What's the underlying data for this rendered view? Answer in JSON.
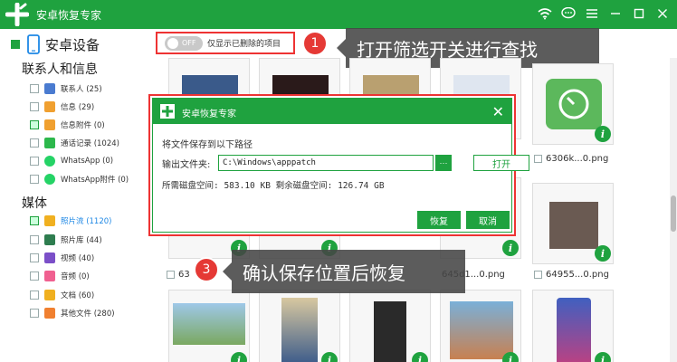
{
  "window": {
    "title": "安卓恢复专家",
    "accent": "#1fa23f"
  },
  "sidebar": {
    "device_label": "安卓设备",
    "sections": [
      {
        "title": "联系人和信息",
        "items": [
          {
            "label": "联系人 (25)",
            "icon": "contacts-icon",
            "color": "#4a7bd0",
            "state": "empty"
          },
          {
            "label": "信息 (29)",
            "icon": "message-icon",
            "color": "#f0a030",
            "state": "empty"
          },
          {
            "label": "信息附件 (0)",
            "icon": "message-attachment-icon",
            "color": "#f0a030",
            "state": "partial"
          },
          {
            "label": "通话记录 (1024)",
            "icon": "call-log-icon",
            "color": "#2db84c",
            "state": "empty"
          },
          {
            "label": "WhatsApp (0)",
            "icon": "whatsapp-icon",
            "color": "#25d366",
            "state": "empty"
          },
          {
            "label": "WhatsApp附件 (0)",
            "icon": "whatsapp-attachment-icon",
            "color": "#25d366",
            "state": "empty"
          }
        ]
      },
      {
        "title": "媒体",
        "items": [
          {
            "label": "照片流 (1120)",
            "icon": "photo-stream-icon",
            "color": "#f0b020",
            "state": "checked"
          },
          {
            "label": "照片库 (44)",
            "icon": "photo-library-icon",
            "color": "#2e7d4f",
            "state": "empty"
          },
          {
            "label": "视频 (40)",
            "icon": "video-icon",
            "color": "#7b4fc8",
            "state": "empty"
          },
          {
            "label": "音频 (0)",
            "icon": "audio-icon",
            "color": "#f06090",
            "state": "empty"
          },
          {
            "label": "文档 (60)",
            "icon": "document-icon",
            "color": "#f0b020",
            "state": "empty"
          },
          {
            "label": "其他文件 (280)",
            "icon": "other-files-icon",
            "color": "#f08030",
            "state": "empty"
          }
        ]
      }
    ]
  },
  "filter": {
    "toggle_text": "OFF",
    "label": "仅显示已删除的项目"
  },
  "callouts": {
    "step1_number": "1",
    "step1_text": "打开筛选开关进行查找",
    "step3_number": "3",
    "step3_text": "确认保存位置后恢复"
  },
  "grid": {
    "captions": {
      "r1c5": "6306k...0.png",
      "r2c1": "63",
      "r2c4": "645d1...0.png",
      "r2c5": "64955...0.png"
    },
    "info_glyph": "i"
  },
  "dialog": {
    "title": "安卓恢复专家",
    "close_glyph": "✕",
    "prompt": "将文件保存到以下路径",
    "output_label": "输出文件夹:",
    "path_value": "C:\\Windows\\apppatch",
    "browse_label": "···",
    "open_label": "打开",
    "space_text": "所需磁盘空间:  583.10 KB  剩余磁盘空间:  126.74 GB",
    "recover_label": "恢复",
    "cancel_label": "取消"
  }
}
